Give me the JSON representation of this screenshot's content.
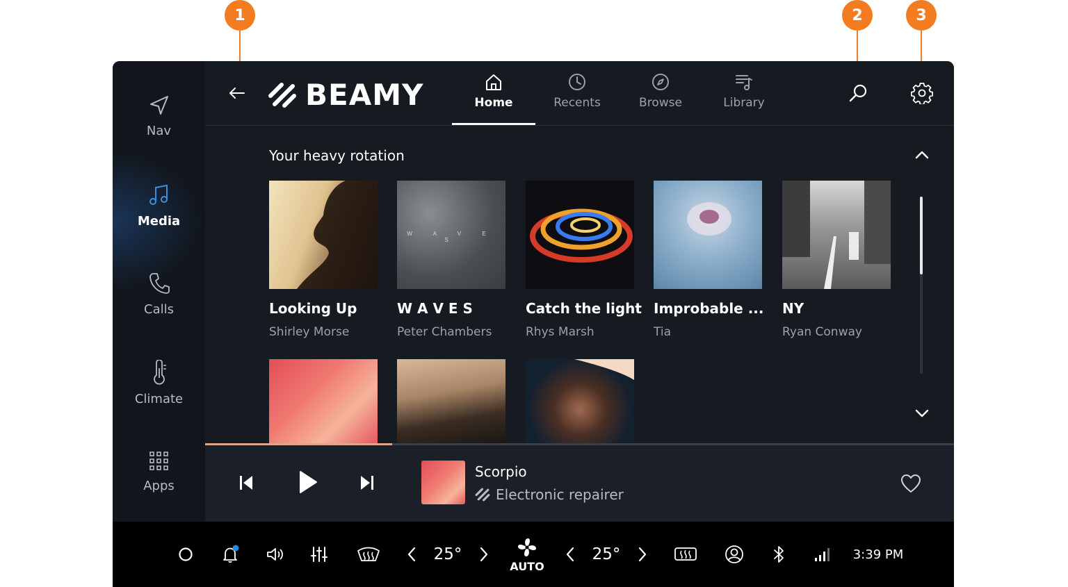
{
  "callouts": [
    "1",
    "2",
    "3"
  ],
  "sidebar": {
    "items": [
      {
        "label": "Nav",
        "icon": "navigation-arrow-icon"
      },
      {
        "label": "Media",
        "icon": "music-note-icon"
      },
      {
        "label": "Calls",
        "icon": "phone-icon"
      },
      {
        "label": "Climate",
        "icon": "thermometer-icon"
      },
      {
        "label": "Apps",
        "icon": "apps-grid-icon"
      }
    ],
    "active": "Media"
  },
  "header": {
    "logo_text": "BEAMY",
    "tabs": [
      {
        "label": "Home",
        "icon": "home-icon"
      },
      {
        "label": "Recents",
        "icon": "clock-icon"
      },
      {
        "label": "Browse",
        "icon": "compass-icon"
      },
      {
        "label": "Library",
        "icon": "library-icon"
      }
    ],
    "active_tab": "Home"
  },
  "section": {
    "title": "Your heavy rotation"
  },
  "albums": [
    {
      "title": "Looking Up",
      "artist": "Shirley Morse"
    },
    {
      "title": "W A V E S",
      "artist": "Peter Chambers",
      "art_text": "W A V E S"
    },
    {
      "title": "Catch the light",
      "artist": "Rhys Marsh"
    },
    {
      "title": "Improbable ...",
      "artist": "Tia"
    },
    {
      "title": "NY",
      "artist": "Ryan Conway"
    }
  ],
  "now_playing": {
    "title": "Scorpio",
    "subtitle": "Electronic repairer",
    "progress": 0.25
  },
  "status": {
    "temp_left": "25°",
    "temp_right": "25°",
    "fan_mode": "AUTO",
    "time": "3:39 PM"
  },
  "colors": {
    "accent": "#f47c20",
    "media_blue": "#3b8fe0",
    "notification_dot": "#2b8ae0"
  }
}
